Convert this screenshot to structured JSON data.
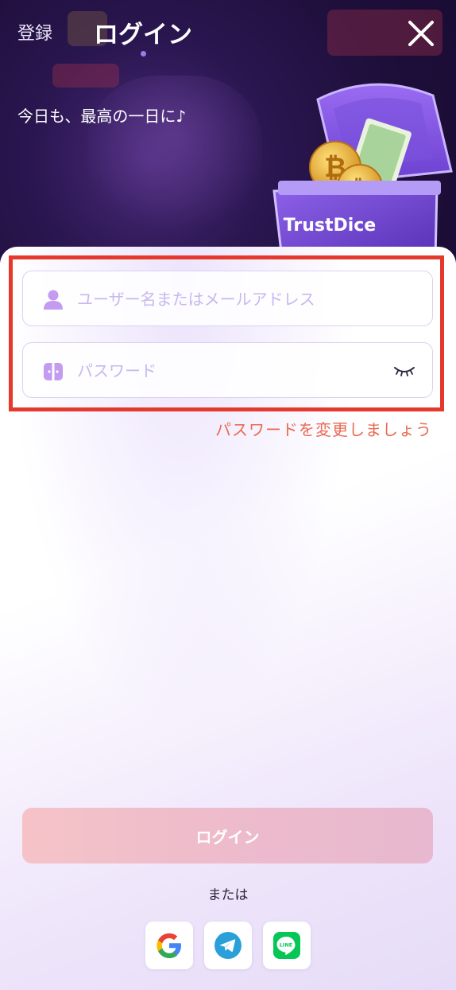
{
  "header": {
    "register_tab": "登録",
    "login_tab": "ログイン",
    "tagline": "今日も、最高の一日に♪"
  },
  "chest_brand": "TrustDice",
  "form": {
    "username_placeholder": "ユーザー名またはメールアドレス",
    "password_placeholder": "パスワード",
    "forgot_password": "パスワードを変更しましょう",
    "login_button": "ログイン"
  },
  "social": {
    "or_text": "または",
    "providers": [
      "google-icon",
      "telegram-icon",
      "line-icon"
    ],
    "line_label": "LINE"
  },
  "colors": {
    "accent": "#9f7ae9",
    "highlight_border": "#e5392d",
    "forgot_text": "#e96a52",
    "login_button": "#f0bfca"
  }
}
